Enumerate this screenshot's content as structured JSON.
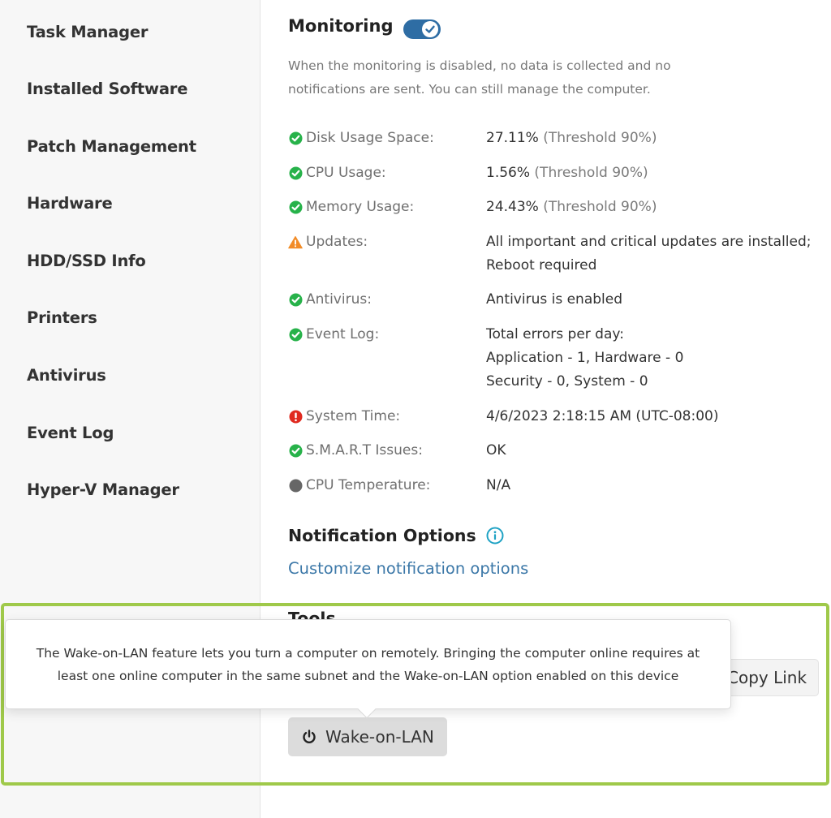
{
  "sidebar": {
    "items": [
      {
        "label": "Task Manager"
      },
      {
        "label": "Installed Software"
      },
      {
        "label": "Patch Management"
      },
      {
        "label": "Hardware"
      },
      {
        "label": "HDD/SSD Info"
      },
      {
        "label": "Printers"
      },
      {
        "label": "Antivirus"
      },
      {
        "label": "Event Log"
      },
      {
        "label": "Hyper-V Manager"
      }
    ]
  },
  "monitoring": {
    "title": "Monitoring",
    "enabled": true,
    "description": "When the monitoring is disabled, no data is collected and no notifications are sent. You can still manage the computer.",
    "rows": [
      {
        "label": "Disk Usage Space:",
        "status": "ok",
        "value": "27.11%",
        "extra": "(Threshold 90%)"
      },
      {
        "label": "CPU Usage:",
        "status": "ok",
        "value": "1.56%",
        "extra": "(Threshold 90%)"
      },
      {
        "label": "Memory Usage:",
        "status": "ok",
        "value": "24.43%",
        "extra": "(Threshold 90%)"
      },
      {
        "label": "Updates:",
        "status": "warning",
        "value_lines": [
          "All important and critical updates are installed;",
          "Reboot required"
        ]
      },
      {
        "label": "Antivirus:",
        "status": "ok",
        "value": "Antivirus is enabled"
      },
      {
        "label": "Event Log:",
        "status": "ok",
        "value_lines": [
          "Total errors per day:",
          "Application - 1, Hardware - 0",
          "Security - 0, System - 0"
        ]
      },
      {
        "label": "System Time:",
        "status": "error",
        "value": "4/6/2023 2:18:15 AM (UTC-08:00)"
      },
      {
        "label": "S.M.A.R.T Issues:",
        "status": "ok",
        "value": "OK"
      },
      {
        "label": "CPU Temperature:",
        "status": "unknown",
        "value": "N/A"
      }
    ]
  },
  "notifications": {
    "title": "Notification Options",
    "link": "Customize notification options"
  },
  "tools": {
    "title": "Tools",
    "copy_link_label": "Copy Link",
    "wol_label": "Wake-on-LAN",
    "tooltip": "The Wake-on-LAN feature lets you turn a computer on remotely. Bringing the computer online requires at least one online computer in the same subnet and the Wake-on-LAN option enabled on this device"
  },
  "colors": {
    "ok": "#27b24a",
    "warning": "#f28c28",
    "error": "#e02a1f",
    "unknown": "#666666",
    "accent": "#2e6da4",
    "highlight": "#9fc94a",
    "info": "#1fa2c4"
  }
}
